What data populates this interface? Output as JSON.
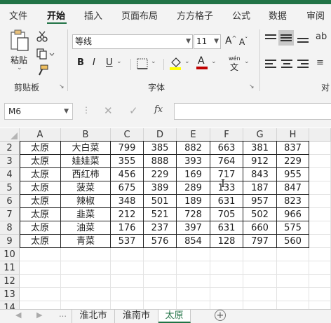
{
  "ribbon_tabs": [
    "文件",
    "开始",
    "插入",
    "页面布局",
    "方方格子",
    "公式",
    "数据",
    "审阅"
  ],
  "clipboard": {
    "paste_label": "粘贴",
    "group_label": "剪贴板"
  },
  "font": {
    "name": "等线",
    "size": "11",
    "phonetic_label": "wén",
    "group_label": "字体",
    "cut_off_group_label": "对"
  },
  "formula_bar": {
    "name_box": "M6",
    "fx_label": "fx",
    "formula": ""
  },
  "columns": [
    "A",
    "B",
    "C",
    "D",
    "E",
    "F",
    "G",
    "H"
  ],
  "row_numbers": [
    "2",
    "3",
    "4",
    "5",
    "6",
    "7",
    "8",
    "9",
    "10",
    "11",
    "12",
    "13",
    "14"
  ],
  "rows": [
    [
      "太原",
      "大白菜",
      "799",
      "385",
      "882",
      "663",
      "381",
      "837"
    ],
    [
      "太原",
      "娃娃菜",
      "355",
      "888",
      "393",
      "764",
      "912",
      "229"
    ],
    [
      "太原",
      "西红柿",
      "456",
      "229",
      "169",
      "717",
      "843",
      "955"
    ],
    [
      "太原",
      "菠菜",
      "675",
      "389",
      "289",
      "133",
      "187",
      "847"
    ],
    [
      "太原",
      "辣椒",
      "348",
      "501",
      "189",
      "631",
      "957",
      "823"
    ],
    [
      "太原",
      "韭菜",
      "212",
      "521",
      "728",
      "705",
      "502",
      "966"
    ],
    [
      "太原",
      "油菜",
      "176",
      "237",
      "397",
      "631",
      "660",
      "575"
    ],
    [
      "太原",
      "青菜",
      "537",
      "576",
      "854",
      "128",
      "797",
      "560"
    ]
  ],
  "sheet_tabs": [
    "淮北市",
    "淮南市",
    "太原"
  ],
  "active_sheet": "太原",
  "colors": {
    "accent": "#217346",
    "font_color_bar": "#c00000",
    "highlight_bar": "#ffff00"
  },
  "icons": [
    "paste-icon",
    "cut-icon",
    "copy-icon",
    "format-painter-icon",
    "bold-icon",
    "italic-icon",
    "underline-icon",
    "border-icon",
    "fill-color-icon",
    "font-color-icon",
    "phonetic-icon",
    "increase-font-icon",
    "decrease-font-icon",
    "align-top-icon",
    "align-middle-icon",
    "align-bottom-icon",
    "align-left-icon",
    "align-center-icon",
    "align-right-icon",
    "cancel-icon",
    "enter-icon",
    "add-sheet-icon"
  ]
}
